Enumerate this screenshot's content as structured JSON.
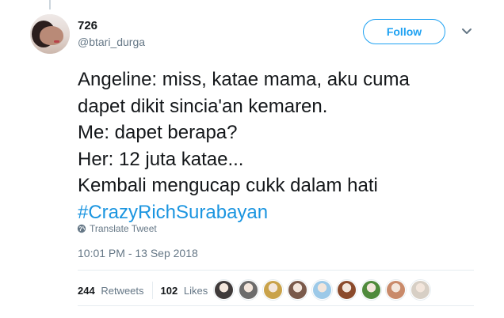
{
  "user": {
    "name": "726",
    "handle": "@btari_durga"
  },
  "follow_label": "Follow",
  "tweet": {
    "lines": [
      "Angeline: miss, katae mama, aku cuma",
      "dapet dikit sincia'an kemaren.",
      "Me: dapet berapa?",
      "Her: 12 juta katae...",
      "Kembali mengucap cukk dalam hati"
    ],
    "hashtag": "#CrazyRichSurabayan"
  },
  "translate_label": "Translate Tweet",
  "timestamp": "10:01 PM - 13 Sep 2018",
  "stats": {
    "retweets": {
      "count": "244",
      "label": "Retweets"
    },
    "likes": {
      "count": "102",
      "label": "Likes"
    }
  },
  "likers": [
    {
      "icon": "liker-avatar-1",
      "color": "#3f3a3a"
    },
    {
      "icon": "liker-avatar-2",
      "color": "#6c6c6c"
    },
    {
      "icon": "liker-avatar-3",
      "color": "#c9a24a"
    },
    {
      "icon": "liker-avatar-4",
      "color": "#7a5a4b"
    },
    {
      "icon": "liker-avatar-5",
      "color": "#9cc9e8"
    },
    {
      "icon": "liker-avatar-6",
      "color": "#8b4a2b"
    },
    {
      "icon": "liker-avatar-7",
      "color": "#4f8a3c"
    },
    {
      "icon": "liker-avatar-8",
      "color": "#c98a6a"
    },
    {
      "icon": "liker-avatar-9",
      "color": "#d7cfc5"
    }
  ],
  "colors": {
    "accent": "#1da1f2",
    "hashtag": "#1b95e0",
    "muted": "#657786",
    "text": "#14171a"
  }
}
